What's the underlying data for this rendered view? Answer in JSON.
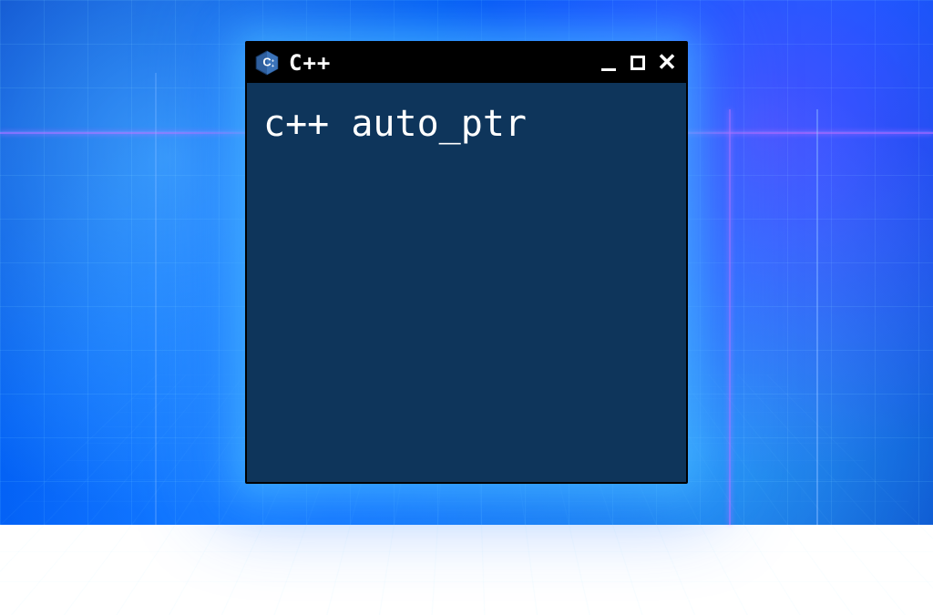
{
  "window": {
    "title": "C++",
    "icon": "cpp-logo",
    "controls": {
      "minimize": "–",
      "maximize": "□",
      "close": "✕"
    }
  },
  "editor": {
    "line1": "c++ auto_ptr"
  },
  "colors": {
    "window_bg": "#0e355b",
    "titlebar_bg": "#000000",
    "text": "#ffffff",
    "glow": "#35c8ff"
  }
}
